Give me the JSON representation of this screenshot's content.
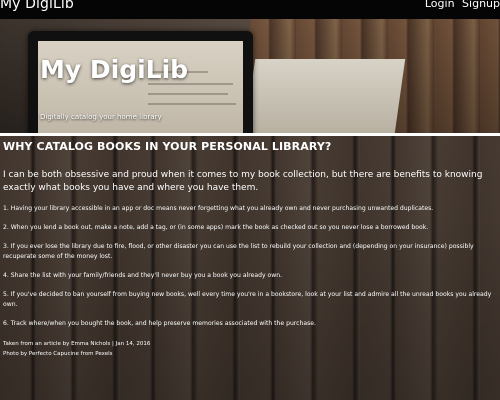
{
  "topbar": {
    "brand": "My DigiLib",
    "nav": {
      "login": "Login",
      "signup": "Signup"
    }
  },
  "hero": {
    "title": "My DigiLib",
    "subtitle": "Digitally catalog your home library"
  },
  "main": {
    "heading": "WHY CATALOG BOOKS IN YOUR PERSONAL LIBRARY?",
    "intro": "I can be both obsessive and proud when it comes to my book collection, but there are benefits to knowing exactly what books you have and where you have them.",
    "reasons": [
      "1. Having your library accessible in an app or doc means never forgetting what you already own and never purchasing unwanted duplicates.",
      "2. When you lend a book out, make a note, add a tag, or (in some apps) mark the book as checked out so you never lose a borrowed book.",
      "3. If you ever lose the library due to fire, flood, or other disaster you can use the list to rebuild your collection and (depending on your insurance) possibly recuperate some of the money lost.",
      "4. Share the list with your family/friends and they'll never buy you a book you already own.",
      "5. If you've decided to ban yourself from buying new books, well every time you're in a bookstore, look at your list and admire all the unread books you already own.",
      "6. Track where/when you bought the book, and help preserve memories associated with the purchase."
    ],
    "credit": "Taken from an article by Emma Nichols | Jan 14, 2016",
    "photo_credit": "Photo by Perfecto Capucine from Pexels"
  }
}
